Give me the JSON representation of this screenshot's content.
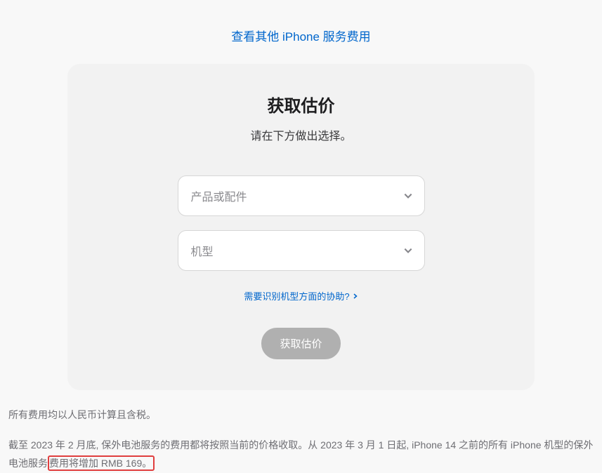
{
  "topLink": {
    "label": "查看其他 iPhone 服务费用"
  },
  "card": {
    "title": "获取估价",
    "subtitle": "请在下方做出选择。",
    "selects": {
      "product": {
        "placeholder": "产品或配件"
      },
      "model": {
        "placeholder": "机型"
      }
    },
    "helpLink": {
      "label": "需要识别机型方面的协助?"
    },
    "button": {
      "label": "获取估价"
    }
  },
  "footer": {
    "line1": "所有费用均以人民币计算且含税。",
    "line2_part1": "截至 2023 年 2 月底, 保外电池服务的费用都将按照当前的价格收取。从 2023 年 3 月 1 日起, iPhone 14 之前的所有 iPhone 机型的保外电池服务",
    "line2_highlight": "费用将增加 RMB 169。"
  }
}
